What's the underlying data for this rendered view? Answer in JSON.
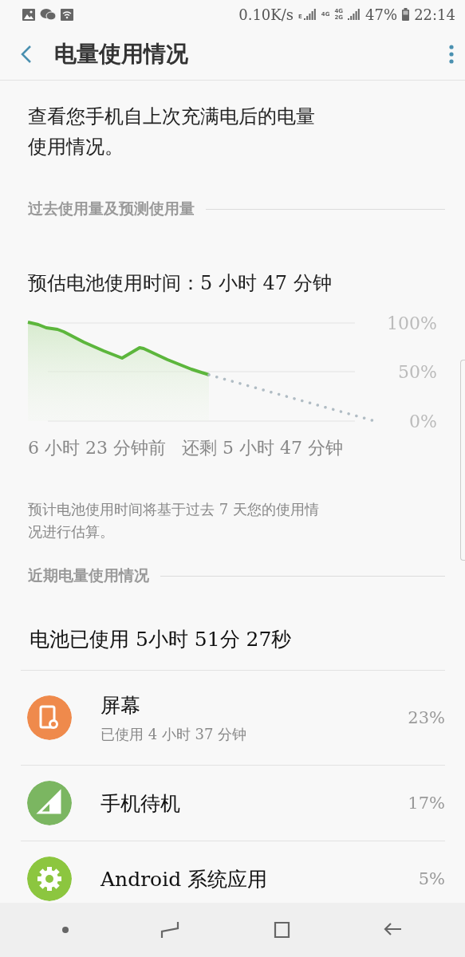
{
  "status_bar": {
    "speed": "0.10K/s",
    "net_badges": [
      "E",
      "4G",
      "4G",
      "2G"
    ],
    "battery": "47%",
    "time": "22:14"
  },
  "toolbar": {
    "title": "电量使用情况"
  },
  "description": "查看您手机自上次充满电后的电量使用情况。",
  "past_section": {
    "header": "过去使用量及预测使用量",
    "estimate": "预估电池使用时间：5 小时 47 分钟",
    "y_labels": [
      "100%",
      "50%",
      "0%"
    ],
    "start_label": "6 小时 23 分钟前",
    "end_label": "还剩 5 小时 47 分钟",
    "footnote": "预计电池使用时间将基于过去 7 天您的使用情况进行估算。"
  },
  "recent_section": {
    "header": "近期电量使用情况",
    "total": "电池已使用 5小时 51分 27秒",
    "items": [
      {
        "kind": "screen",
        "color": "#ef8a4c",
        "name": "屏幕",
        "detail": "已使用 4 小时 37 分钟",
        "percent": "23%"
      },
      {
        "kind": "standby",
        "color": "#7bb661",
        "name": "手机待机",
        "percent": "17%"
      },
      {
        "kind": "system",
        "color": "#8cc63f",
        "name": "Android 系统应用",
        "percent": "5%"
      }
    ]
  }
}
